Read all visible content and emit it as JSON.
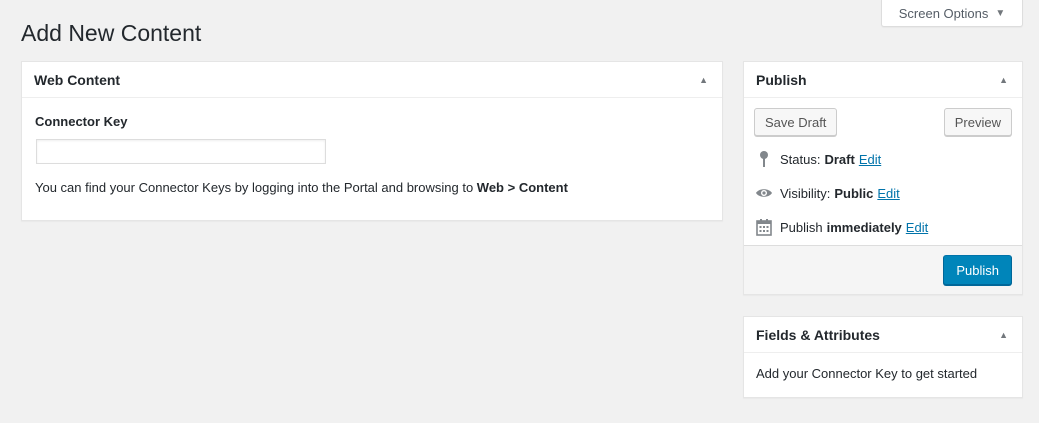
{
  "screen_options": {
    "label": "Screen Options",
    "caret": "▼"
  },
  "page": {
    "title": "Add New Content"
  },
  "web_content": {
    "title": "Web Content",
    "toggle": "▲",
    "field_label": "Connector Key",
    "input_value": "",
    "help_prefix": "You can find your Connector Keys by logging into the Portal and browsing to ",
    "help_bold": "Web > Content"
  },
  "publish": {
    "title": "Publish",
    "toggle": "▲",
    "save_draft_label": "Save Draft",
    "preview_label": "Preview",
    "status_label": "Status:",
    "status_value": "Draft",
    "visibility_label": "Visibility:",
    "visibility_value": "Public",
    "schedule_label": "Publish",
    "schedule_value": "immediately",
    "edit_label": "Edit",
    "publish_button_label": "Publish"
  },
  "fields": {
    "title": "Fields & Attributes",
    "toggle": "▲",
    "message": "Add your Connector Key to get started"
  },
  "icons": {
    "pin": "pin-icon",
    "eye": "eye-icon",
    "calendar": "calendar-icon"
  },
  "colors": {
    "link": "#0073aa",
    "primary": "#0085ba",
    "background": "#f1f1f1"
  }
}
